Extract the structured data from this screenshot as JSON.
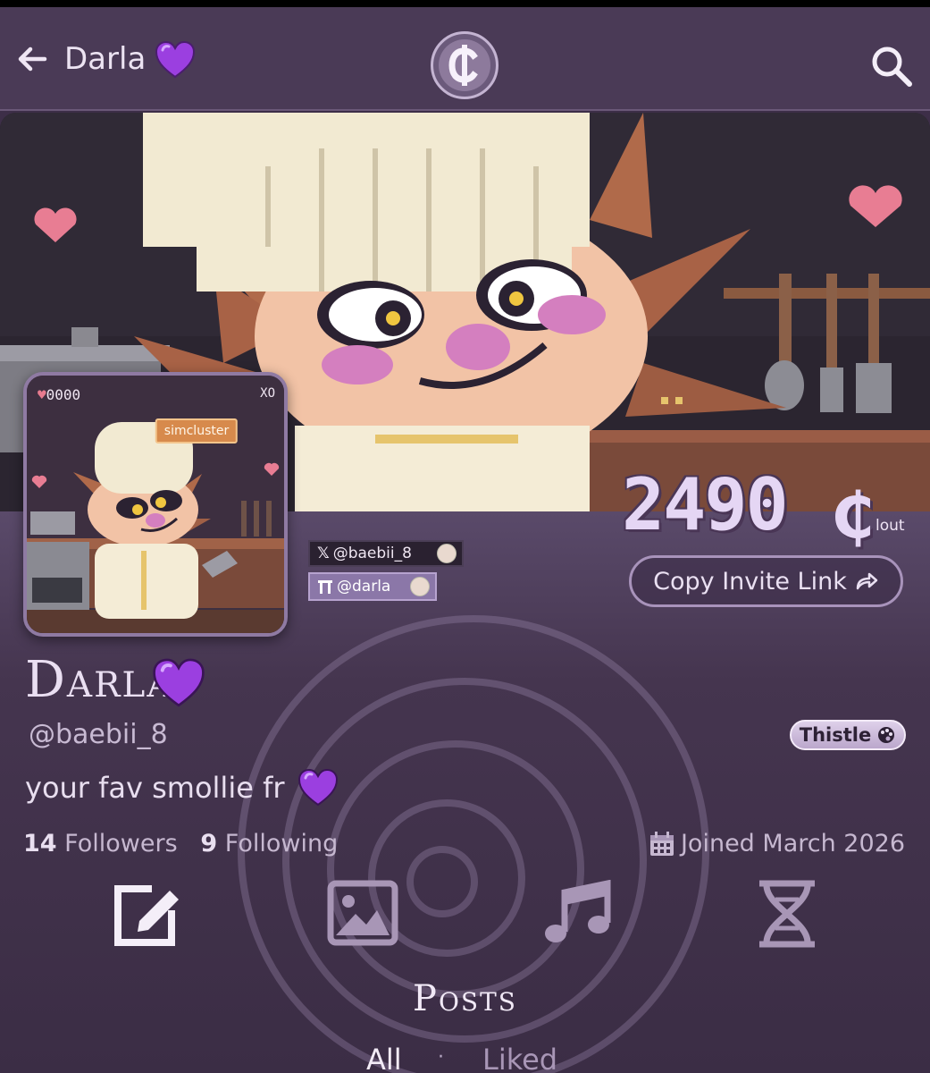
{
  "header": {
    "title": "Darla",
    "title_emoji": "purple-heart",
    "back_icon": "arrow-left-icon",
    "logo_icon": "clout-logo-icon",
    "search_icon": "search-icon"
  },
  "banner": {
    "image": "pixel-art chef character banner"
  },
  "avatar_card": {
    "lives": "0000",
    "corner_text": "XO",
    "tag": "simcluster"
  },
  "socials": {
    "x_handle": "@baebii_8",
    "sc_handle": "@darla"
  },
  "clout": {
    "value": "2490",
    "symbol": "₵",
    "unit": "lout"
  },
  "invite_button": {
    "label": "Copy Invite Link"
  },
  "profile": {
    "display_name": "Darla",
    "handle": "@baebii_8",
    "bio": "your fav smollie fr",
    "theme_badge": "Thistle",
    "followers_count": "14",
    "followers_label": "Followers",
    "following_count": "9",
    "following_label": "Following",
    "joined": "Joined March 2026"
  },
  "tabs": [
    {
      "icon": "edit-icon"
    },
    {
      "icon": "image-icon"
    },
    {
      "icon": "music-icon"
    },
    {
      "icon": "dna-icon"
    }
  ],
  "posts": {
    "title": "Posts",
    "filter_all": "All",
    "filter_separator": "·",
    "filter_liked": "Liked"
  },
  "colors": {
    "background": "#3d2e48",
    "header": "#4a3a56",
    "accent": "#a893bb",
    "heart": "#9b3fe0"
  }
}
